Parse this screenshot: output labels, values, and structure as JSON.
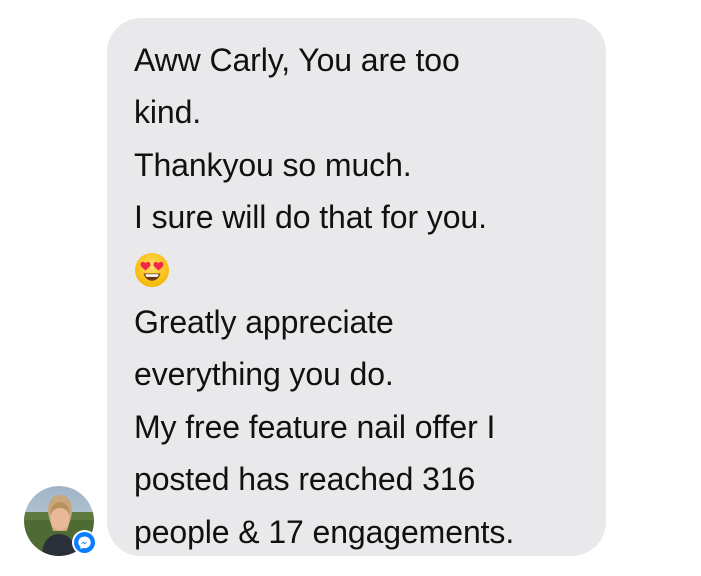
{
  "message": {
    "lines_before_emoji": [
      "Aww Carly,  You are too",
      "kind.",
      "Thankyou so much.",
      "I sure will do that for you."
    ],
    "emoji_icon": "smiling-face-with-heart-eyes",
    "lines_after_emoji": [
      "Greatly appreciate",
      "everything you do.",
      "My free feature nail offer I",
      "posted has reached 316",
      "people & 17 engagements."
    ]
  },
  "sender": {
    "avatar_icon": "profile-photo",
    "badge_icon": "messenger-icon"
  },
  "colors": {
    "bubble": "#e9e9eb",
    "text": "#111111",
    "messenger_blue": "#0a7cff"
  }
}
